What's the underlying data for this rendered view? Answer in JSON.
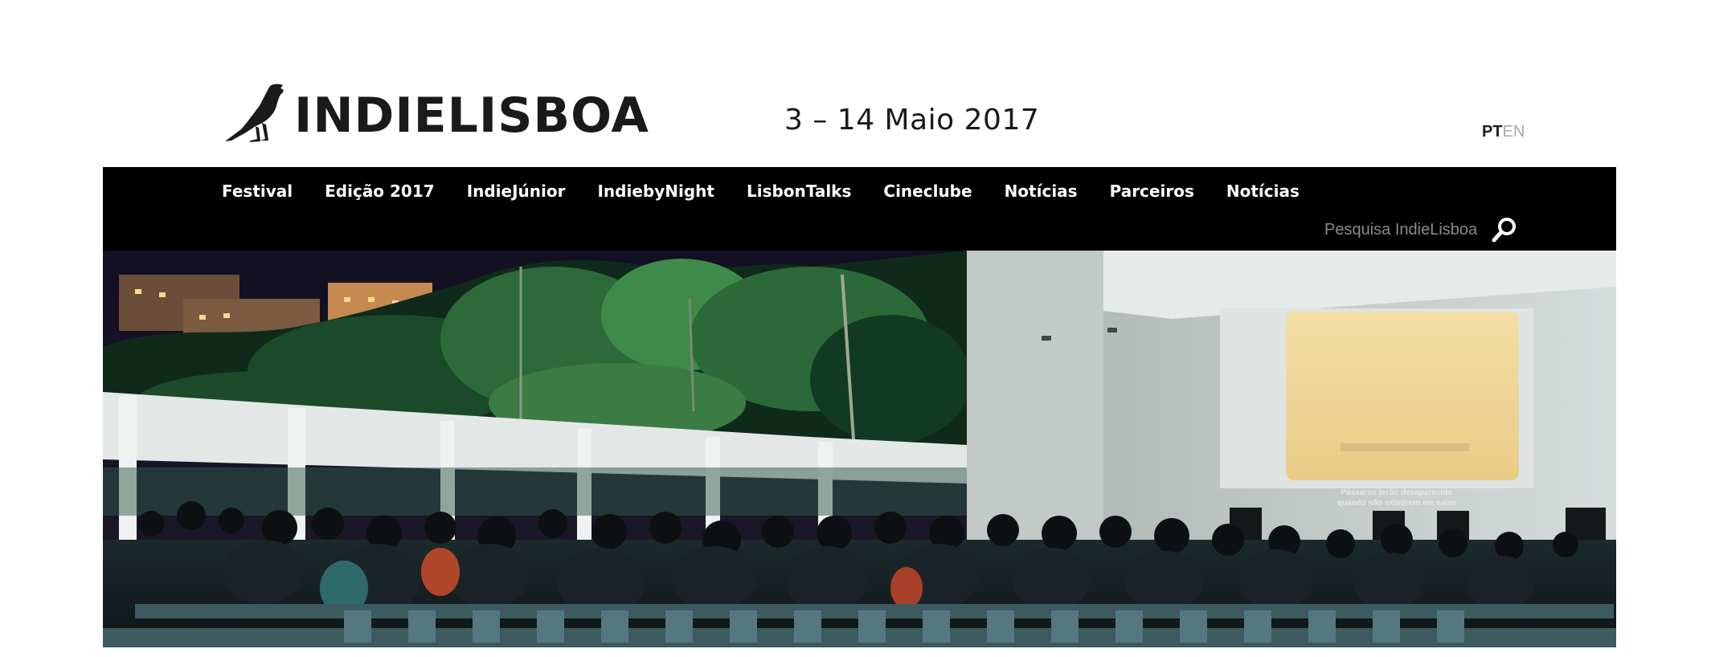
{
  "header": {
    "logo_text": "INDIELISBOA",
    "logo_icon": "blackbird-icon",
    "dates": "3 – 14 Maio 2017",
    "lang": {
      "pt": "PT",
      "en": "EN"
    }
  },
  "nav": {
    "items": [
      {
        "label": "Festival"
      },
      {
        "label": "Edição 2017"
      },
      {
        "label": "IndieJúnior"
      },
      {
        "label": "IndiebyNight"
      },
      {
        "label": "LisbonTalks"
      },
      {
        "label": "Cineclube"
      },
      {
        "label": "Notícias"
      },
      {
        "label": "Parceiros"
      },
      {
        "label": "Notícias"
      }
    ],
    "search": {
      "placeholder": "Pesquisa IndieLisboa",
      "icon": "search-icon"
    }
  },
  "hero": {
    "subtitle_line1": "Pássaros terão desaparecido",
    "subtitle_line2": "quando não existirem em salas"
  },
  "colors": {
    "navbar": "#000000",
    "text": "#1a1a1a",
    "lang_inactive": "#a8a8a8",
    "placeholder": "#8a8a8a"
  }
}
